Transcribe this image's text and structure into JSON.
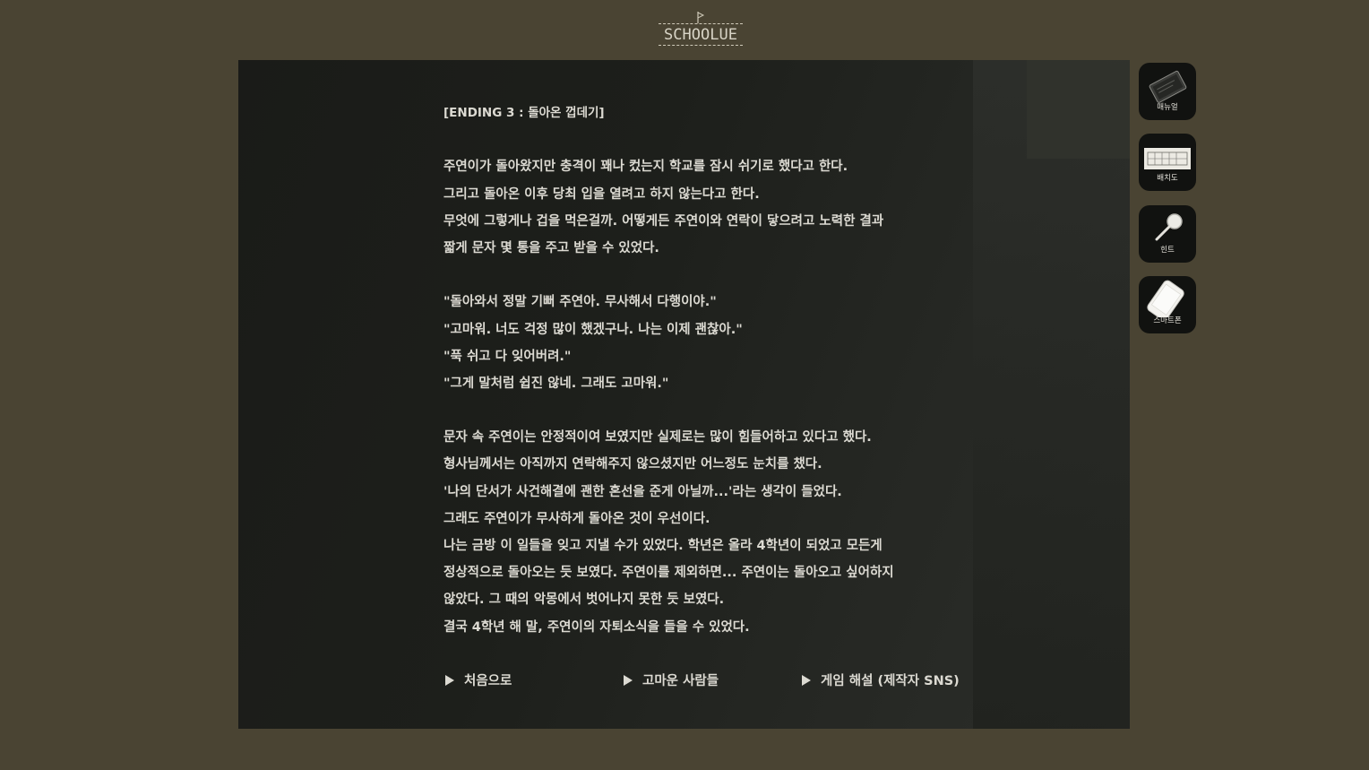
{
  "header": {
    "logo_text": "SCHOOLUE"
  },
  "story": {
    "title": "[ENDING 3 : 돌아온 껍데기]",
    "paragraphs": [
      [
        "주연이가 돌아왔지만 충격이 꽤나 컸는지 학교를 잠시 쉬기로 했다고 한다.",
        "그리고 돌아온 이후 당최 입을 열려고 하지 않는다고 한다.",
        "무엇에 그렇게나 겁을 먹은걸까. 어떻게든 주연이와 연락이 닿으려고 노력한 결과",
        "짧게 문자 몇 통을 주고 받을 수 있었다."
      ],
      [
        "\"돌아와서 정말 기뻐 주연아. 무사해서 다행이야.\"",
        "\"고마워. 너도 걱정 많이 했겠구나. 나는 이제 괜찮아.\"",
        "\"푹 쉬고 다 잊어버려.\"",
        "\"그게 말처럼 쉽진 않네. 그래도 고마워.\""
      ],
      [
        "문자 속 주연이는 안정적이여 보였지만 실제로는 많이 힘들어하고 있다고 했다.",
        "형사님께서는 아직까지 연락해주지 않으셨지만 어느정도 눈치를 챘다.",
        "'나의 단서가 사건해결에 괜한 혼선을 준게 아닐까...'라는 생각이 들었다.",
        "그래도 주연이가 무사하게 돌아온 것이 우선이다.",
        "나는 금방 이 일들을 잊고 지낼 수가 있었다. 학년은 올라 4학년이 되었고 모든게",
        "정상적으로 돌아오는 듯 보였다. 주연이를 제외하면... 주연이는 돌아오고 싶어하지",
        "않았다. 그 때의 악몽에서 벗어나지 못한 듯 보였다.",
        "결국 4학년 해 말, 주연이의 자퇴소식을 들을 수 있었다."
      ]
    ]
  },
  "choices": [
    "처음으로",
    "고마운 사람들",
    "게임 해설 (제작자 SNS)"
  ],
  "sidebar": [
    {
      "label": "매뉴얼",
      "icon": "manual-icon"
    },
    {
      "label": "배치도",
      "icon": "floor-plan-icon"
    },
    {
      "label": "힌트",
      "icon": "magnifier-icon"
    },
    {
      "label": "스마트폰",
      "icon": "smartphone-icon"
    }
  ]
}
